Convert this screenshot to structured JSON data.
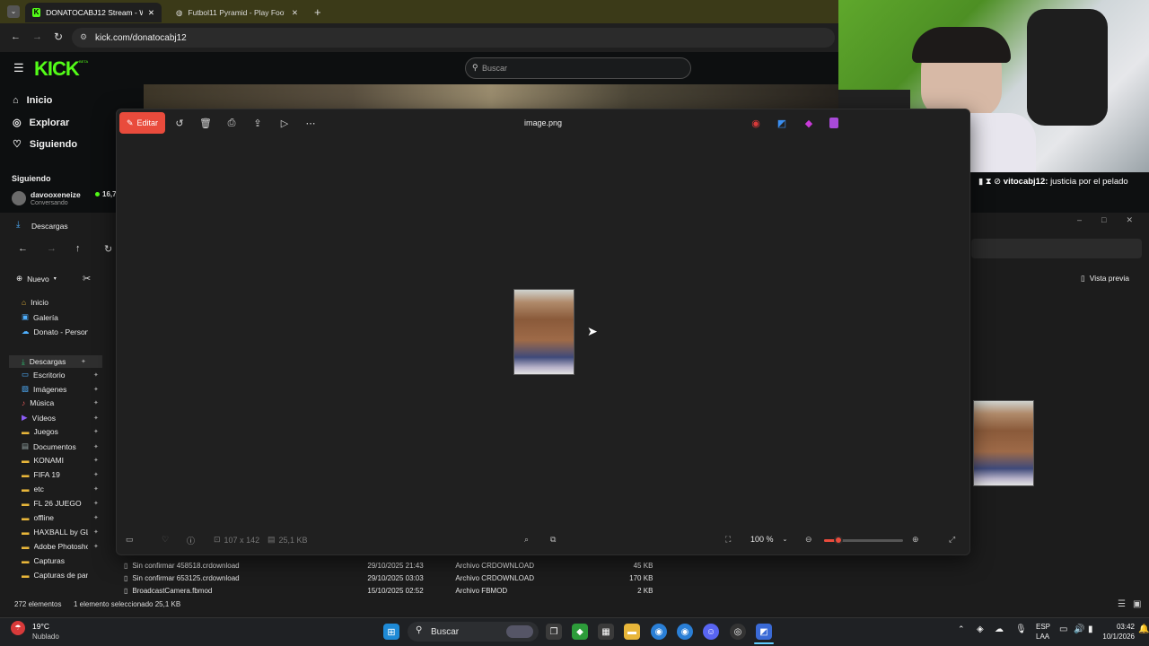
{
  "browser": {
    "tabs": [
      {
        "label": "DONATOCABJ12 Stream - Watc",
        "active": true
      },
      {
        "label": "Futbol11 Pyramid - Play Footb",
        "active": false
      }
    ],
    "url": "kick.com/donatocabj12"
  },
  "kick": {
    "logo": "KICK",
    "logo_badge": "BETA",
    "search_placeholder": "Buscar",
    "nav": [
      "Inicio",
      "Explorar",
      "Siguiendo"
    ],
    "following_header": "Siguiendo",
    "following_user": "davooxeneize",
    "following_status": "Conversando",
    "following_viewers": "16,7",
    "chat_user": "vitocabj12",
    "chat_message": "justicia por el pelado"
  },
  "explorer": {
    "title": "Descargas",
    "new_label": "Nuevo",
    "preview_label": "Vista previa",
    "sidebar": [
      {
        "label": "Inicio",
        "icon": "home-icon",
        "pinned": false
      },
      {
        "label": "Galería",
        "icon": "gallery-icon",
        "pinned": false
      },
      {
        "label": "Donato - Personal",
        "icon": "cloud-icon",
        "pinned": false
      },
      {
        "label": "Descargas",
        "icon": "download-icon",
        "pinned": true
      },
      {
        "label": "Escritorio",
        "icon": "desktop-icon",
        "pinned": true
      },
      {
        "label": "Imágenes",
        "icon": "pictures-icon",
        "pinned": true
      },
      {
        "label": "Música",
        "icon": "music-icon",
        "pinned": true
      },
      {
        "label": "Vídeos",
        "icon": "videos-icon",
        "pinned": true
      },
      {
        "label": "Juegos",
        "icon": "folder-icon",
        "pinned": true
      },
      {
        "label": "Documentos",
        "icon": "documents-icon",
        "pinned": true
      },
      {
        "label": "KONAMI",
        "icon": "folder-icon",
        "pinned": true
      },
      {
        "label": "FIFA 19",
        "icon": "folder-icon",
        "pinned": true
      },
      {
        "label": "etc",
        "icon": "folder-icon",
        "pinned": true
      },
      {
        "label": "FL 26 JUEGO",
        "icon": "folder-icon",
        "pinned": true
      },
      {
        "label": "offline",
        "icon": "folder-icon",
        "pinned": true
      },
      {
        "label": "HAXBALL by GLH",
        "icon": "folder-icon",
        "pinned": true
      },
      {
        "label": "Adobe Photoshop",
        "icon": "folder-icon",
        "pinned": true
      },
      {
        "label": "Capturas",
        "icon": "folder-icon",
        "pinned": false
      },
      {
        "label": "Capturas de pantalla",
        "icon": "folder-icon",
        "pinned": false
      }
    ],
    "files": [
      {
        "name": "Sin confirmar 458518.crdownload",
        "date": "29/10/2025 21:43",
        "type": "Archivo CRDOWNLOAD",
        "size": "45 KB"
      },
      {
        "name": "Sin confirmar 653125.crdownload",
        "date": "29/10/2025 03:03",
        "type": "Archivo CRDOWNLOAD",
        "size": "170 KB"
      },
      {
        "name": "BroadcastCamera.fbmod",
        "date": "15/10/2025 02:52",
        "type": "Archivo FBMOD",
        "size": "2 KB"
      }
    ],
    "status": "272 elementos",
    "selection": "1 elemento seleccionado 25,1 KB"
  },
  "viewer": {
    "edit_label": "Editar",
    "image_name": "image.png",
    "dimensions": "107 x 142",
    "file_size": "25,1 KB",
    "zoom": "100 %",
    "zoom_fraction": 0.18
  },
  "taskbar": {
    "weather_temp": "19°C",
    "weather_desc": "Nublado",
    "search_placeholder": "Buscar",
    "lang_top": "ESP",
    "lang_bottom": "LAA",
    "time": "03:42",
    "date": "10/1/2026"
  }
}
